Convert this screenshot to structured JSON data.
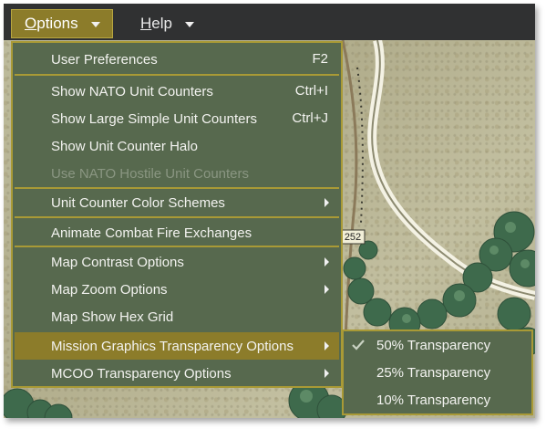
{
  "menubar": {
    "items": [
      {
        "accel": "O",
        "rest": "ptions",
        "active": true
      },
      {
        "accel": "H",
        "rest": "elp",
        "active": false
      }
    ]
  },
  "options_menu": {
    "items": [
      {
        "label": "User Preferences",
        "shortcut": "F2"
      },
      {
        "label": "Show NATO Unit Counters",
        "shortcut": "Ctrl+I"
      },
      {
        "label": "Show Large Simple Unit Counters",
        "shortcut": "Ctrl+J"
      },
      {
        "label": "Show Unit Counter Halo",
        "shortcut": ""
      },
      {
        "label": "Use NATO Hostile Unit Counters",
        "shortcut": "",
        "disabled": true
      },
      {
        "label": "Unit Counter Color Schemes",
        "submenu": true
      },
      {
        "label": "Animate Combat Fire Exchanges"
      },
      {
        "label": "Map Contrast Options",
        "submenu": true
      },
      {
        "label": "Map Zoom Options",
        "submenu": true
      },
      {
        "label": "Map Show Hex Grid"
      },
      {
        "label": "Mission Graphics Transparency Options",
        "submenu": true,
        "selected": true
      },
      {
        "label": "MCOO Transparency Options",
        "submenu": true
      }
    ]
  },
  "transparency_submenu": {
    "items": [
      {
        "label": "50% Transparency",
        "checked": true
      },
      {
        "label": "25% Transparency",
        "checked": false
      },
      {
        "label": "10% Transparency",
        "checked": false
      }
    ]
  },
  "map": {
    "road_marker": "252"
  },
  "colors": {
    "menubar_bg": "#303132",
    "menu_bg": "#57694e",
    "menu_border": "#a99a36",
    "highlight": "#8c7c2a",
    "disabled_text": "#8a9682"
  },
  "icons": {
    "menu_caret": "chevron-down-icon",
    "submenu_arrow": "chevron-right-icon",
    "checkmark": "check-icon"
  }
}
